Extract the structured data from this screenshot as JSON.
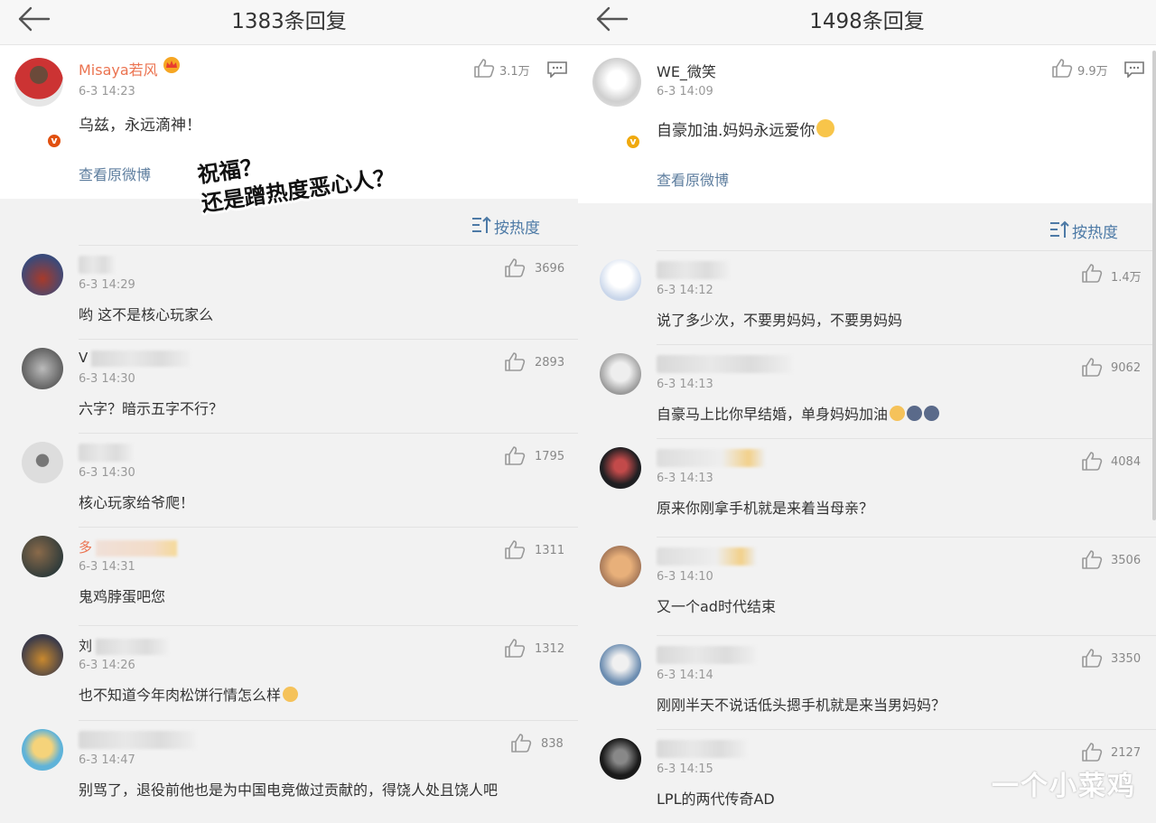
{
  "left": {
    "title": "1383条回复",
    "original": {
      "name": "Misaya若风",
      "time": "6-3 14:23",
      "text": "乌兹，永远滴神！",
      "likes": "3.1万",
      "link": "查看原微博"
    },
    "sort_label": "按热度",
    "comments": [
      {
        "time": "6-3 14:29",
        "text": "哟 这不是核心玩家么",
        "likes": "3696",
        "name_hint": ""
      },
      {
        "time": "6-3 14:30",
        "text": "六字？暗示五字不行？",
        "likes": "2893",
        "name_hint": "V"
      },
      {
        "time": "6-3 14:30",
        "text": "核心玩家给爷爬！",
        "likes": "1795",
        "name_hint": ""
      },
      {
        "time": "6-3 14:31",
        "text": "鬼鸡脖蛋吧您",
        "likes": "1311",
        "name_hint": "多"
      },
      {
        "time": "6-3 14:26",
        "text": "也不知道今年肉松饼行情怎么样",
        "likes": "1312",
        "name_hint": "刘"
      },
      {
        "time": "6-3 14:47",
        "text": "别骂了，退役前他也是为中国电竞做过贡献的，得饶人处且饶人吧",
        "likes": "838",
        "name_hint": ""
      }
    ]
  },
  "right": {
    "title": "1498条回复",
    "original": {
      "name": "WE_微笑",
      "time": "6-3 14:09",
      "text": "自豪加油.妈妈永远爱你",
      "likes": "9.9万",
      "link": "查看原微博"
    },
    "sort_label": "按热度",
    "comments": [
      {
        "time": "6-3 14:12",
        "text": "说了多少次，不要男妈妈，不要男妈妈",
        "likes": "1.4万"
      },
      {
        "time": "6-3 14:13",
        "text": "自豪马上比你早结婚，单身妈妈加油",
        "likes": "9062"
      },
      {
        "time": "6-3 14:13",
        "text": "原来你刚拿手机就是来着当母亲？",
        "likes": "4084"
      },
      {
        "time": "6-3 14:10",
        "text": "又一个ad时代结束",
        "likes": "3506"
      },
      {
        "time": "6-3 14:14",
        "text": "刚刚半天不说话低头摁手机就是来当男妈妈？",
        "likes": "3350"
      },
      {
        "time": "6-3 14:15",
        "text": "LPL的两代传奇AD",
        "likes": "2127"
      }
    ]
  },
  "overlay": {
    "line1": "祝福？",
    "line2": "还是蹭热度恶心人？"
  },
  "watermark": "一个小菜鸡",
  "colors": {
    "link": "#5d7d9e",
    "sort": "#4d7aa6",
    "vip_name": "#eb7350",
    "verified_red": "#e1500f",
    "verified_gold": "#f0a90e"
  }
}
